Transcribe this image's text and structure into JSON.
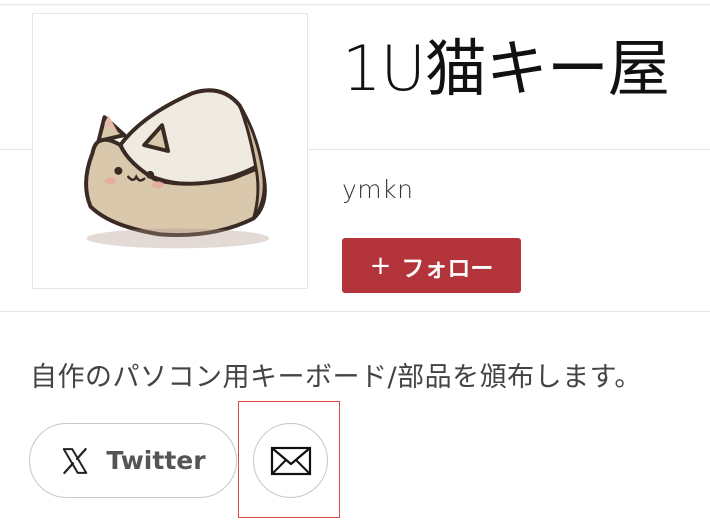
{
  "shop": {
    "title": "1U猫キー屋",
    "owner": "ymkn",
    "description": "自作のパソコン用キーボード/部品を頒布します。"
  },
  "follow": {
    "plus": "+",
    "label": "フォロー"
  },
  "social": {
    "twitter_label": "Twitter"
  },
  "icons": {
    "avatar": "cat-keycap-icon",
    "twitter": "x-logo-icon",
    "mail": "envelope-icon"
  },
  "colors": {
    "follow_button": "#b3343a",
    "highlight_border": "#e04a4a"
  }
}
